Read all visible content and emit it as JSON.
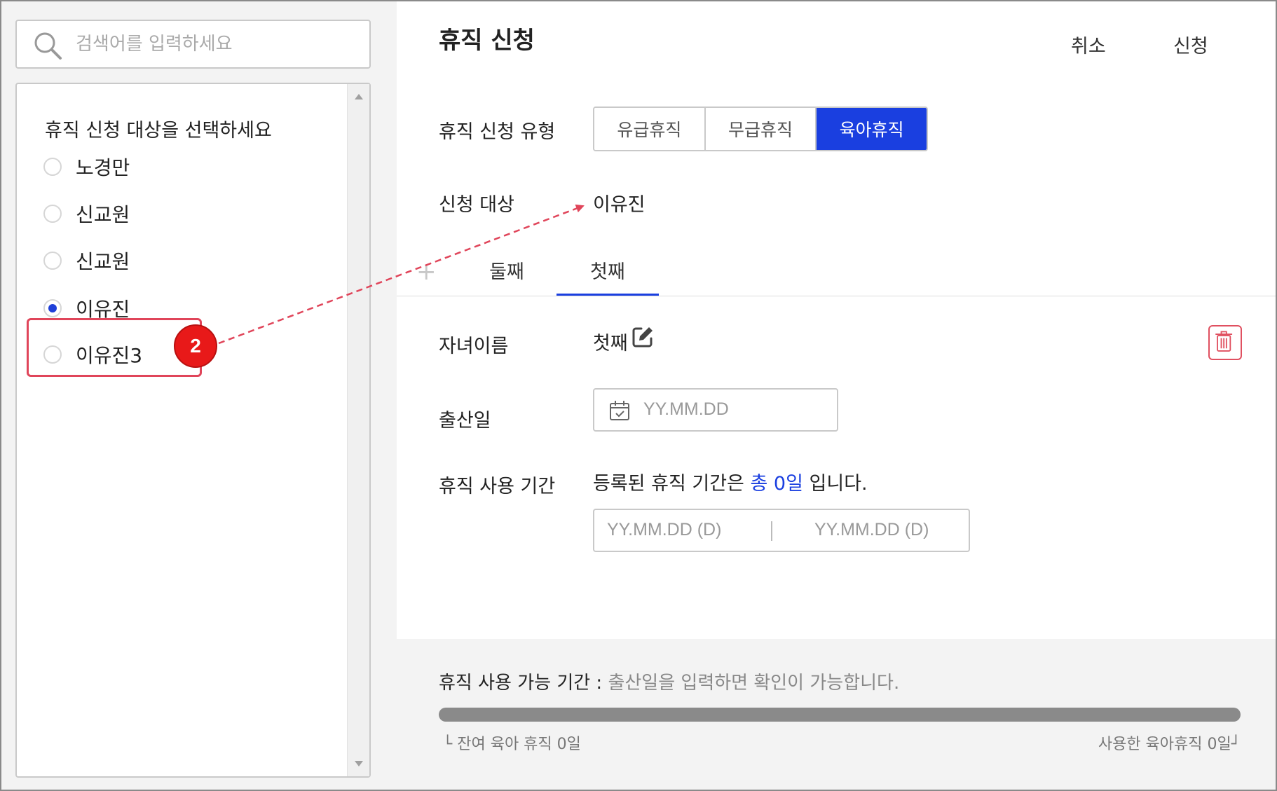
{
  "search": {
    "placeholder": "검색어를 입력하세요"
  },
  "target_list": {
    "title": "휴직 신청 대상을 선택하세요",
    "items": [
      {
        "label": "노경만",
        "selected": false
      },
      {
        "label": "신교원",
        "selected": false
      },
      {
        "label": "신교원",
        "selected": false
      },
      {
        "label": "이유진",
        "selected": true
      },
      {
        "label": "이유진3",
        "selected": false
      }
    ]
  },
  "annotation": {
    "step_badge": "2",
    "badge_color": "#e81919",
    "arrow_color": "#e0455a"
  },
  "header": {
    "title": "휴직 신청",
    "cancel_label": "취소",
    "submit_label": "신청"
  },
  "form": {
    "leave_type_label": "휴직 신청 유형",
    "leave_types": [
      "유급휴직",
      "무급휴직",
      "육아휴직"
    ],
    "leave_type_selected": "육아휴직",
    "target_label": "신청 대상",
    "target_value": "이유진",
    "tabs": [
      "둘째",
      "첫째"
    ],
    "active_tab": "첫째",
    "add_tab_symbol": "+",
    "child_name_label": "자녀이름",
    "child_name_value": "첫째",
    "birth_date_label": "출산일",
    "birth_date_placeholder": "YY.MM.DD",
    "period_label": "휴직 사용 기간",
    "period_text_prefix": "등록된 휴직 기간은",
    "period_total": "총 0일",
    "period_text_suffix": "입니다.",
    "period_start_placeholder": "YY.MM.DD (D)",
    "period_end_placeholder": "YY.MM.DD (D)"
  },
  "footer": {
    "title_label": "휴직 사용 가능 기간 :",
    "title_hint": "출산일을 입력하면 확인이 가능합니다.",
    "progress_percent": 0,
    "remaining_note": "└ 잔여 육아 휴직 0일",
    "used_note": "사용한 육아휴직 0일┘"
  },
  "colors": {
    "accent": "#1a3fe0",
    "danger": "#e05060",
    "highlight": "#e0455a"
  }
}
